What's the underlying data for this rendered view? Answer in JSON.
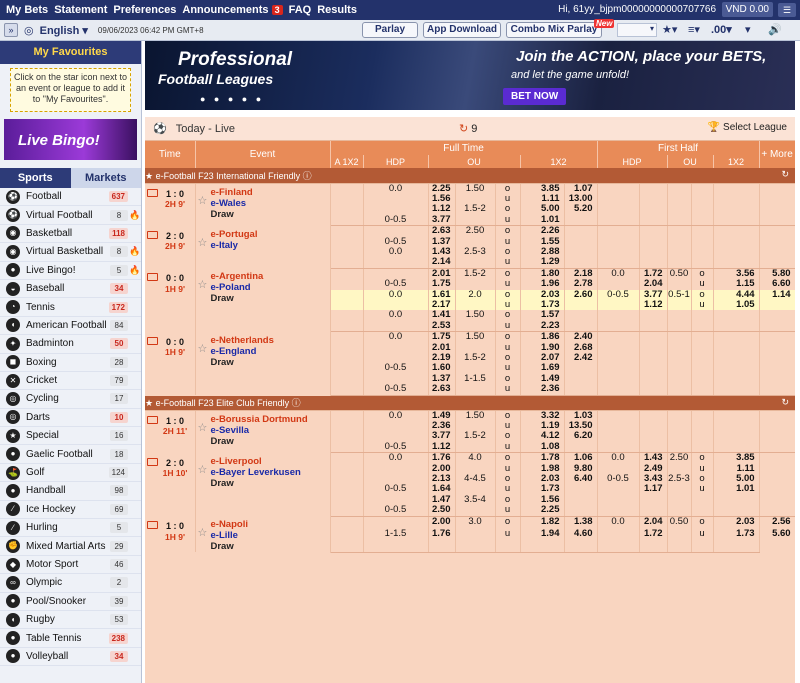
{
  "topnav": {
    "items": [
      "My Bets",
      "Statement",
      "Preferences",
      "Announcements",
      "FAQ",
      "Results"
    ],
    "announce_count": "3",
    "greeting": "Hi, 61yy_bjpm00000000000707766",
    "currency": "VND",
    "balance": "0.00"
  },
  "subbar": {
    "language": "English",
    "datetime": "09/06/2023 06:42 PM GMT+8",
    "buttons": [
      "Parlay",
      "App Download",
      "Combo Mix Parlay"
    ],
    "new_badge": "New",
    "odds_type": ".00"
  },
  "sidebar": {
    "fav_title": "My Favourites",
    "fav_hint": "Click on the star icon next to an event or league to add it to \"My Favourites\".",
    "bingo": "Live Bingo!",
    "tab_sports": "Sports",
    "tab_markets": "Markets",
    "sports": [
      {
        "name": "Football",
        "count": "637",
        "hot": true
      },
      {
        "name": "Virtual Football",
        "count": "8",
        "hot": false,
        "fire": true
      },
      {
        "name": "Basketball",
        "count": "118",
        "hot": true
      },
      {
        "name": "Virtual Basketball",
        "count": "8",
        "hot": false,
        "fire": true
      },
      {
        "name": "Live Bingo!",
        "count": "5",
        "hot": false,
        "fire": true
      },
      {
        "name": "Baseball",
        "count": "34",
        "hot": true
      },
      {
        "name": "Tennis",
        "count": "172",
        "hot": true
      },
      {
        "name": "American Football",
        "count": "84",
        "hot": false
      },
      {
        "name": "Badminton",
        "count": "50",
        "hot": true
      },
      {
        "name": "Boxing",
        "count": "28",
        "hot": false
      },
      {
        "name": "Cricket",
        "count": "79",
        "hot": false
      },
      {
        "name": "Cycling",
        "count": "17",
        "hot": false
      },
      {
        "name": "Darts",
        "count": "10",
        "hot": true
      },
      {
        "name": "Special",
        "count": "16",
        "hot": false
      },
      {
        "name": "Gaelic Football",
        "count": "18",
        "hot": false
      },
      {
        "name": "Golf",
        "count": "124",
        "hot": false
      },
      {
        "name": "Handball",
        "count": "98",
        "hot": false
      },
      {
        "name": "Ice Hockey",
        "count": "69",
        "hot": false
      },
      {
        "name": "Hurling",
        "count": "5",
        "hot": false
      },
      {
        "name": "Mixed Martial Arts",
        "count": "29",
        "hot": false
      },
      {
        "name": "Motor Sport",
        "count": "46",
        "hot": false
      },
      {
        "name": "Olympic",
        "count": "2",
        "hot": false
      },
      {
        "name": "Pool/Snooker",
        "count": "39",
        "hot": false
      },
      {
        "name": "Rugby",
        "count": "53",
        "hot": false
      },
      {
        "name": "Table Tennis",
        "count": "238",
        "hot": true
      },
      {
        "name": "Volleyball",
        "count": "34",
        "hot": true
      }
    ]
  },
  "banner": {
    "title": "Professional",
    "subtitle": "Football Leagues",
    "tagline": "Join the ACTION, place your BETS,",
    "tagline2": "and let the game unfold!",
    "cta": "BET NOW"
  },
  "header": {
    "title": "Today - Live",
    "count": "9",
    "select_league": "Select League"
  },
  "columns": {
    "time": "Time",
    "event": "Event",
    "full_time": "Full Time",
    "first_half": "First Half",
    "more": "+ More",
    "sub": [
      "A 1X2",
      "HDP",
      "OU",
      "1X2",
      "HDP",
      "OU",
      "1X2"
    ]
  },
  "leagues": [
    {
      "name": "e-Football F23 International Friendly",
      "matches": [
        {
          "score": "1 : 0",
          "time": "2H 9'",
          "home": "e-Finland",
          "away": "e-Wales",
          "draw": "Draw",
          "more": "+ 2",
          "lines": [
            {
              "fh": "0.0",
              "fo": [
                "2.25",
                "1.56"
              ],
              "fou": "1.50",
              "foo": [
                "3.85",
                "1.11"
              ],
              "f1": [
                "1.07",
                "13.00",
                "5.20"
              ]
            },
            {
              "fh": "",
              "fo": [
                "1.12",
                "3.77"
              ],
              "fhx": "0-0.5",
              "fou": "1.5-2",
              "foo": [
                "5.00",
                "1.01"
              ]
            }
          ]
        },
        {
          "score": "2 : 0",
          "time": "2H 9'",
          "home": "e-Portugal",
          "away": "e-Italy",
          "draw": "",
          "more": "+ 1",
          "lines": [
            {
              "fhx": "0-0.5",
              "fo": [
                "2.63",
                "1.37"
              ],
              "fou": "2.50",
              "foo": [
                "2.26",
                "1.55"
              ]
            },
            {
              "fh": "0.0",
              "fo": [
                "1.43",
                "2.14"
              ],
              "fou": "2.5-3",
              "foo": [
                "2.88",
                "1.29"
              ]
            }
          ]
        },
        {
          "score": "0 : 0",
          "time": "1H 9'",
          "home": "e-Argentina",
          "away": "e-Poland",
          "draw": "Draw",
          "more": "+ 5",
          "lines": [
            {
              "fhx": "0-0.5",
              "fo": [
                "2.01",
                "1.75"
              ],
              "fou": "1.5-2",
              "foo": [
                "1.80",
                "1.96"
              ],
              "f1": [
                "2.18",
                "2.78",
                "2.60"
              ],
              "hh": "0.0",
              "ho": [
                "1.72",
                "2.04"
              ],
              "hou": "0.50",
              "hoo": [
                "3.56",
                "1.15"
              ],
              "h1": [
                "5.80",
                "6.60",
                "1.14"
              ]
            },
            {
              "fh": "0.0",
              "fo": [
                "1.61",
                "2.17"
              ],
              "fou": "2.0",
              "foo": [
                "2.03",
                "1.73"
              ],
              "hhx": "0-0.5",
              "ho": [
                "3.77",
                "1.12"
              ],
              "hou": "0.5-1",
              "hoo": [
                "4.44",
                "1.05"
              ],
              "hl": true
            },
            {
              "fh": "0.0",
              "fo": [
                "1.41",
                "2.53"
              ],
              "fou": "1.50",
              "foo": [
                "1.57",
                "2.23"
              ]
            }
          ]
        },
        {
          "score": "0 : 0",
          "time": "1H 9'",
          "home": "e-Netherlands",
          "away": "e-England",
          "draw": "Draw",
          "more": "+ 4",
          "lines": [
            {
              "fh": "0.0",
              "fo": [
                "1.75",
                "2.01"
              ],
              "fou": "1.50",
              "foo": [
                "1.86",
                "1.90"
              ],
              "f1": [
                "2.40",
                "2.68",
                "2.42"
              ]
            },
            {
              "fhx": "0-0.5",
              "fo": [
                "2.19",
                "1.60"
              ],
              "fou": "1.5-2",
              "foo": [
                "2.07",
                "1.69"
              ]
            },
            {
              "fhx": "0-0.5",
              "fo": [
                "1.37",
                "2.63"
              ],
              "fou": "1-1.5",
              "foo": [
                "1.49",
                "2.36"
              ]
            }
          ]
        }
      ]
    },
    {
      "name": "e-Football F23 Elite Club Friendly",
      "matches": [
        {
          "score": "1 : 0",
          "time": "2H 11'",
          "home": "e-Borussia Dortmund",
          "away": "e-Sevilla",
          "draw": "Draw",
          "more": "+ 2",
          "lines": [
            {
              "fh": "0.0",
              "fo": [
                "1.49",
                "2.36"
              ],
              "fou": "1.50",
              "foo": [
                "3.32",
                "1.19"
              ],
              "f1": [
                "1.03",
                "13.50",
                "6.20"
              ]
            },
            {
              "fhx": "0-0.5",
              "fo": [
                "3.77",
                "1.12"
              ],
              "fou": "1.5-2",
              "foo": [
                "4.12",
                "1.08"
              ]
            }
          ]
        },
        {
          "score": "2 : 0",
          "time": "1H 10'",
          "home": "e-Liverpool",
          "away": "e-Bayer Leverkusen",
          "draw": "Draw",
          "more": "+ 4",
          "lines": [
            {
              "fh": "0.0",
              "fo": [
                "1.76",
                "2.00"
              ],
              "fou": "4.0",
              "foo": [
                "1.78",
                "1.98"
              ],
              "f1": [
                "1.06",
                "9.80",
                "6.40"
              ],
              "hh": "0.0",
              "ho": [
                "1.43",
                "2.49"
              ],
              "hou": "2.50",
              "hoo": [
                "3.85",
                "1.11"
              ]
            },
            {
              "fhx": "0-0.5",
              "fo": [
                "2.13",
                "1.64"
              ],
              "fou": "4-4.5",
              "foo": [
                "2.03",
                "1.73"
              ],
              "hhx": "0-0.5",
              "ho": [
                "3.43",
                "1.17"
              ],
              "hou": "2.5-3",
              "hoo": [
                "5.00",
                "1.01"
              ]
            },
            {
              "fhx": "0-0.5",
              "fo": [
                "1.47",
                "2.50"
              ],
              "fou": "3.5-4",
              "foo": [
                "1.56",
                "2.25"
              ]
            }
          ]
        },
        {
          "score": "1 : 0",
          "time": "1H 9'",
          "home": "e-Napoli",
          "away": "e-Lille",
          "draw": "Draw",
          "more": "+ 5",
          "lines": [
            {
              "fhx": "1-1.5",
              "fo": [
                "2.00",
                "1.76"
              ],
              "fou": "3.0",
              "foo": [
                "1.82",
                "1.94"
              ],
              "f1": [
                "1.38",
                "4.60",
                "3.76"
              ],
              "hh": "0.0",
              "ho": [
                "2.04",
                "1.72"
              ],
              "hou": "0.50",
              "hoo": [
                "2.03",
                "1.73"
              ],
              "h1": [
                "2.56",
                "5.60",
                "1.57"
              ]
            }
          ]
        }
      ]
    }
  ]
}
